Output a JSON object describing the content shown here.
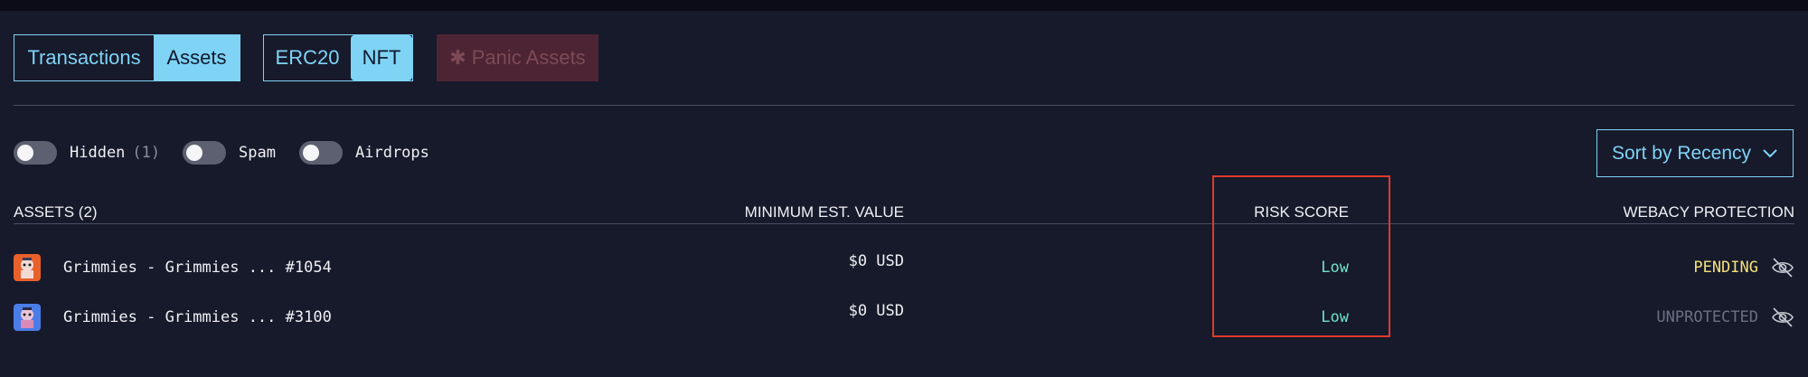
{
  "tabs": {
    "transactions": "Transactions",
    "assets": "Assets"
  },
  "asset_types": {
    "erc20": "ERC20",
    "nft": "NFT"
  },
  "panic_button": {
    "icon": "asterisk-icon",
    "label": "Panic Assets"
  },
  "filters": {
    "hidden": {
      "label": "Hidden",
      "count": "(1)"
    },
    "spam": {
      "label": "Spam"
    },
    "airdrops": {
      "label": "Airdrops"
    }
  },
  "sort": {
    "label": "Sort by Recency",
    "icon": "chevron-down-icon"
  },
  "columns": {
    "assets": "ASSETS (2)",
    "value": "MINIMUM EST. VALUE",
    "risk": "RISK SCORE",
    "protection": "WEBACY PROTECTION"
  },
  "rows": [
    {
      "name": "Grimmies - Grimmies ... #1054",
      "value": "$0 USD",
      "risk": "Low",
      "protection": "PENDING",
      "protection_color": "#f5e07a"
    },
    {
      "name": "Grimmies - Grimmies ... #3100",
      "value": "$0 USD",
      "risk": "Low",
      "protection": "UNPROTECTED",
      "protection_color": "#6b7080"
    }
  ],
  "colors": {
    "accent": "#7fd3f5",
    "background": "#171a2b",
    "risk_low": "#6fe3c8",
    "highlight": "#e03a2a"
  }
}
